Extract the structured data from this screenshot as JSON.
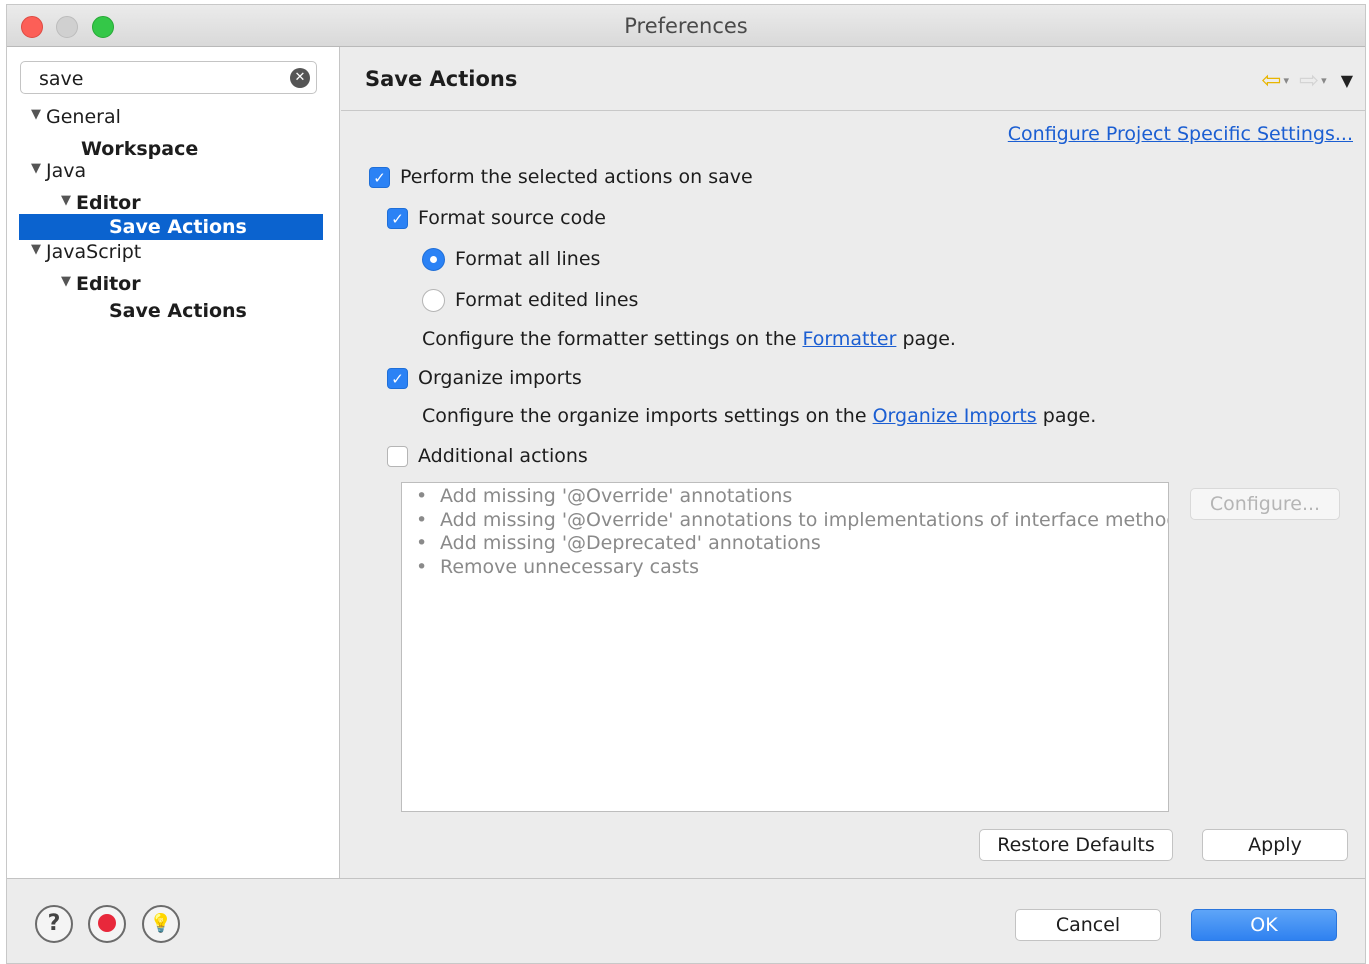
{
  "window": {
    "title": "Preferences"
  },
  "search": {
    "value": "save"
  },
  "tree": [
    {
      "label": "General",
      "expanded": true,
      "level": 0
    },
    {
      "label": "Workspace",
      "level": 1
    },
    {
      "label": "Java",
      "expanded": true,
      "level": 0
    },
    {
      "label": "Editor",
      "expanded": true,
      "level": 1
    },
    {
      "label": "Save Actions",
      "level": 2,
      "selected": true
    },
    {
      "label": "JavaScript",
      "expanded": true,
      "level": 0
    },
    {
      "label": "Editor",
      "expanded": true,
      "level": 1
    },
    {
      "label": "Save Actions",
      "level": 2
    }
  ],
  "page": {
    "title": "Save Actions",
    "project_link": "Configure Project Specific Settings..."
  },
  "options": {
    "perform_on_save": {
      "label": "Perform the selected actions on save",
      "checked": true
    },
    "format_source": {
      "label": "Format source code",
      "checked": true
    },
    "format_all": {
      "label": "Format all lines",
      "selected": true
    },
    "format_edited": {
      "label": "Format edited lines",
      "selected": false
    },
    "formatter_note": {
      "prefix": "Configure the formatter settings on the",
      "link": "Formatter",
      "suffix": "page."
    },
    "organize_imports": {
      "label": "Organize imports",
      "checked": true
    },
    "organize_note": {
      "prefix": "Configure the organize imports settings on the",
      "link": "Organize Imports",
      "suffix": "page."
    },
    "additional_actions": {
      "label": "Additional actions",
      "checked": false
    }
  },
  "additional_list": [
    "Add missing '@Override' annotations",
    "Add missing '@Override' annotations to implementations of interface methods",
    "Add missing '@Deprecated' annotations",
    "Remove unnecessary casts"
  ],
  "buttons": {
    "configure": "Configure...",
    "restore_defaults": "Restore Defaults",
    "apply": "Apply",
    "cancel": "Cancel",
    "ok": "OK"
  },
  "icons": {
    "bullet": "•",
    "check": "✓",
    "triangle_down": "▼",
    "back": "⇦",
    "forward": "⇨",
    "small_drop": "▾",
    "view_menu": "▼",
    "clear": "✕",
    "help": "?",
    "hint": "💡"
  },
  "colors": {
    "selection": "#0b63cf",
    "link": "#1b5ed2",
    "checkbox_on": "#2b82f5",
    "back_arrow": "#e8b500"
  }
}
